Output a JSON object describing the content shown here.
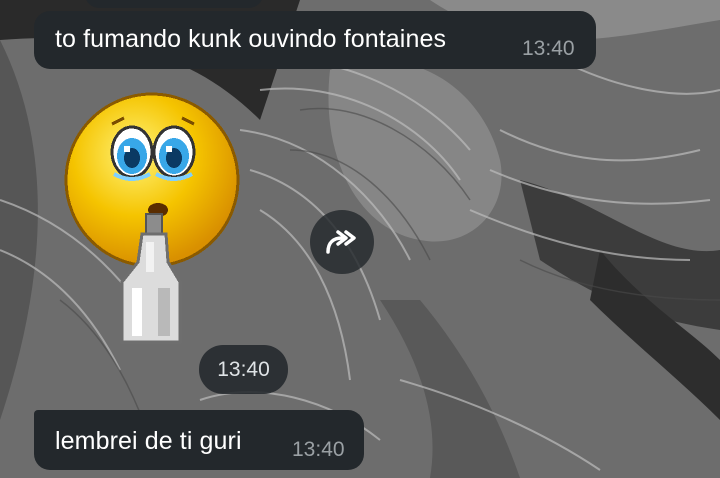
{
  "chat": {
    "messages": [
      {
        "text": "to fumando kunk ouvindo fontaines",
        "time": "13:40"
      },
      {
        "text": "lembrei de ti guri",
        "time": "13:40"
      }
    ],
    "sticker": {
      "time": "13:40",
      "icon": "pleading-emoji-holding-bottle-sticker"
    }
  },
  "icons": {
    "forward": "forward-arrow-icon"
  },
  "colors": {
    "bubble_bg": "#23282c",
    "text": "#ffffff",
    "timestamp": "#9aa0a4",
    "wallpaper": "#6b6b6b",
    "sticker_face": "#f5c400"
  }
}
